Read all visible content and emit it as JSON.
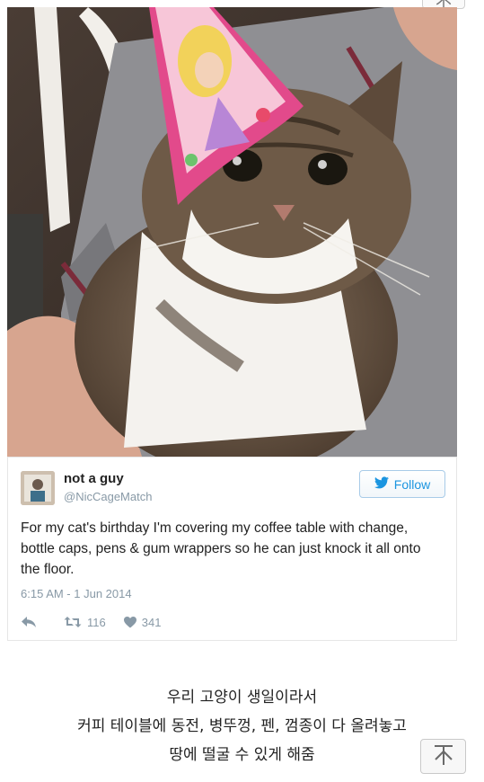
{
  "top_button": {
    "icon": "scroll-top-icon"
  },
  "photo": {
    "subject": "cat-in-party-hat-photo"
  },
  "tweet": {
    "name": "not a guy",
    "handle": "@NicCageMatch",
    "follow_label": "Follow",
    "text": "For my cat's birthday I'm covering my coffee table with change, bottle caps, pens & gum wrappers so he can just knock it all onto the floor.",
    "timestamp": "6:15 AM - 1 Jun 2014",
    "retweet_count": "116",
    "like_count": "341",
    "colors": {
      "follow_blue": "#1b95e0",
      "meta_gray": "#8899a6"
    }
  },
  "caption": {
    "line1": "우리 고양이 생일이라서",
    "line2": "커피 테이블에 동전, 병뚜껑, 펜, 껌종이 다 올려놓고",
    "line3": "땅에 떨굴 수 있게 해줌"
  },
  "scroll_top": {
    "icon": "scroll-top-icon"
  }
}
